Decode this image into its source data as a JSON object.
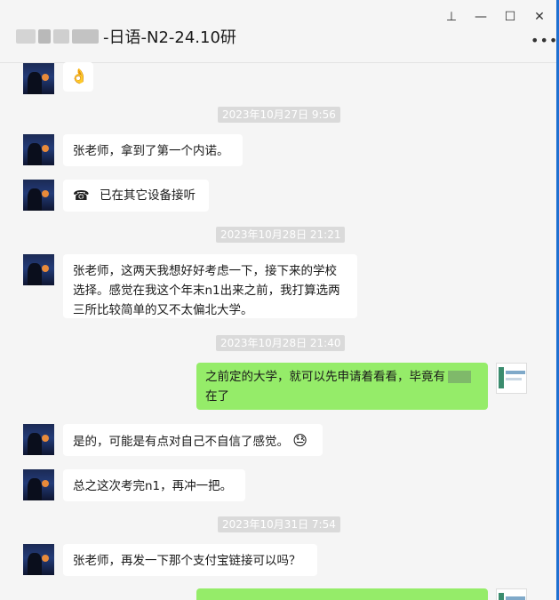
{
  "window": {
    "title": "-日语-N2-24.10研",
    "pin_label": "⊥",
    "minimize_label": "—",
    "maximize_label": "☐",
    "close_label": "✕",
    "more_label": "•••"
  },
  "messages": {
    "m0_emoji": "👌",
    "ts1": "2023年10月27日 9:56",
    "m1": "张老师，拿到了第一个内诺。",
    "m2_call_icon": "☎",
    "m2": "已在其它设备接听",
    "ts2": "2023年10月28日 21:21",
    "m3_line1": "张老师，这两天我想好好考虑一下，接下来的学校",
    "m3_line2": "选择。感觉在我这个年末n1出来之前，我打算选两",
    "m3_line3": "三所比较简单的又不太偏北大学。",
    "ts3": "2023年10月28日 21:40",
    "m4_line1": "之前定的大学，就可以先申请着看看，毕竟有",
    "m4_line2": "在了",
    "m5": "是的，可能是有点对自己不自信了感觉。",
    "m5_emoji": "😓",
    "m6": "总之这次考完n1，再冲一把。",
    "ts4": "2023年10月31日 7:54",
    "m7": "张老师，再发一下那个支付宝链接可以吗？"
  }
}
